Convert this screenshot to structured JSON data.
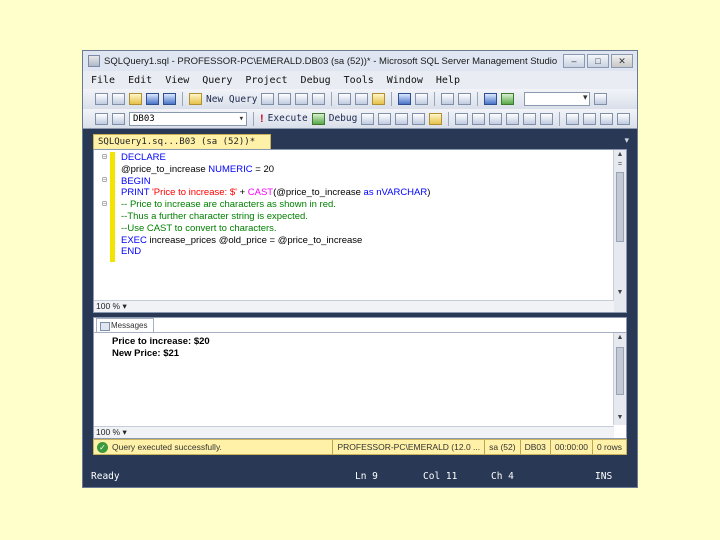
{
  "window": {
    "title": "SQLQuery1.sql - PROFESSOR-PC\\EMERALD.DB03 (sa (52))* - Microsoft SQL Server Management Studio",
    "minimize": "–",
    "maximize": "□",
    "close": "✕"
  },
  "menu": [
    "File",
    "Edit",
    "View",
    "Query",
    "Project",
    "Debug",
    "Tools",
    "Window",
    "Help"
  ],
  "toolbar": {
    "new_query": "New Query",
    "database": "DB03",
    "execute": "Execute",
    "debug": "Debug"
  },
  "tab": {
    "label": "SQLQuery1.sq...B03 (sa (52))*",
    "close": "×"
  },
  "editor": {
    "lines": [
      {
        "parts": [
          {
            "t": "kw",
            "v": "DECLARE"
          }
        ]
      },
      {
        "parts": [
          {
            "t": "txt",
            "v": "@price_to_increase "
          },
          {
            "t": "kw",
            "v": "NUMERIC"
          },
          {
            "t": "txt",
            "v": " = 20"
          }
        ]
      },
      {
        "parts": [
          {
            "t": "kw",
            "v": "BEGIN"
          }
        ]
      },
      {
        "parts": [
          {
            "t": "kw",
            "v": "PRINT "
          },
          {
            "t": "str",
            "v": "'Price to increase: $' "
          },
          {
            "t": "txt",
            "v": "+ "
          },
          {
            "t": "fn",
            "v": "CAST"
          },
          {
            "t": "txt",
            "v": "(@price_to_increase "
          },
          {
            "t": "kw",
            "v": "as nVARCHAR"
          },
          {
            "t": "txt",
            "v": ")"
          }
        ]
      },
      {
        "parts": [
          {
            "t": "cmt",
            "v": "-- Price to increase are characters as shown in red."
          }
        ]
      },
      {
        "parts": [
          {
            "t": "cmt",
            "v": "--Thus a further character string is expected."
          }
        ]
      },
      {
        "parts": [
          {
            "t": "cmt",
            "v": "--Use CAST to convert to characters."
          }
        ]
      },
      {
        "parts": [
          {
            "t": "kw",
            "v": "EXEC "
          },
          {
            "t": "txt",
            "v": "increase_prices @old_price = @price_to_increase"
          }
        ]
      },
      {
        "parts": [
          {
            "t": "kw",
            "v": "END"
          }
        ]
      }
    ],
    "zoom": "100 %"
  },
  "results": {
    "tab_label": "Messages",
    "messages": [
      "Price to increase: $20",
      "New Price: $21"
    ],
    "zoom": "100 %"
  },
  "query_status": {
    "message": "Query executed successfully.",
    "server": "PROFESSOR-PC\\EMERALD (12.0 ...",
    "user": "sa (52)",
    "database": "DB03",
    "elapsed": "00:00:00",
    "rows": "0 rows"
  },
  "statusbar": {
    "ready": "Ready",
    "ln": "Ln 9",
    "col": "Col 11",
    "ch": "Ch 4",
    "ins": "INS"
  }
}
